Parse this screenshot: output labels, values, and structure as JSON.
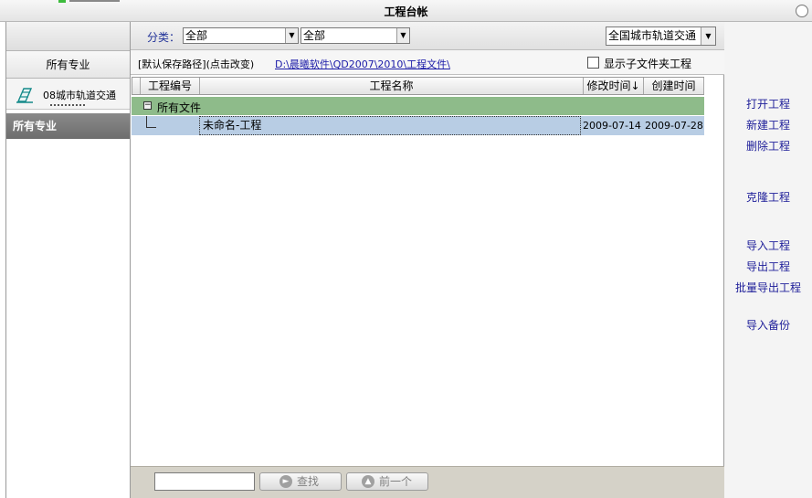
{
  "window": {
    "title": "工程台帐"
  },
  "sidebar": {
    "all_specialties_tab": "所有专业",
    "category_item": "08城市轨道交通",
    "selected_item": "所有专业"
  },
  "filter": {
    "label": "分类：",
    "category1": "全部",
    "category2": "全部",
    "region": "全国城市轨道交通"
  },
  "path": {
    "label": "[默认保存路径](点击改变)",
    "value": "D:\\晨曦软件\\QD2007\\2010\\工程文件\\",
    "show_subfolder_label": "显示子文件夹工程",
    "show_subfolder_checked": false
  },
  "table": {
    "columns": [
      "工程编号",
      "工程名称",
      "修改时间↓",
      "创建时间"
    ],
    "group_label": "所有文件",
    "rows": [
      {
        "number": "",
        "name": "未命名-工程",
        "modified": "2009-07-14",
        "created": "2009-07-28"
      }
    ]
  },
  "search": {
    "input_value": "",
    "find_label": "查找",
    "prev_label": "前一个"
  },
  "actions": {
    "open": "打开工程",
    "new": "新建工程",
    "delete": "删除工程",
    "clone": "克隆工程",
    "import": "导入工程",
    "export": "导出工程",
    "batch_export": "批量导出工程",
    "import_backup": "导入备份"
  }
}
